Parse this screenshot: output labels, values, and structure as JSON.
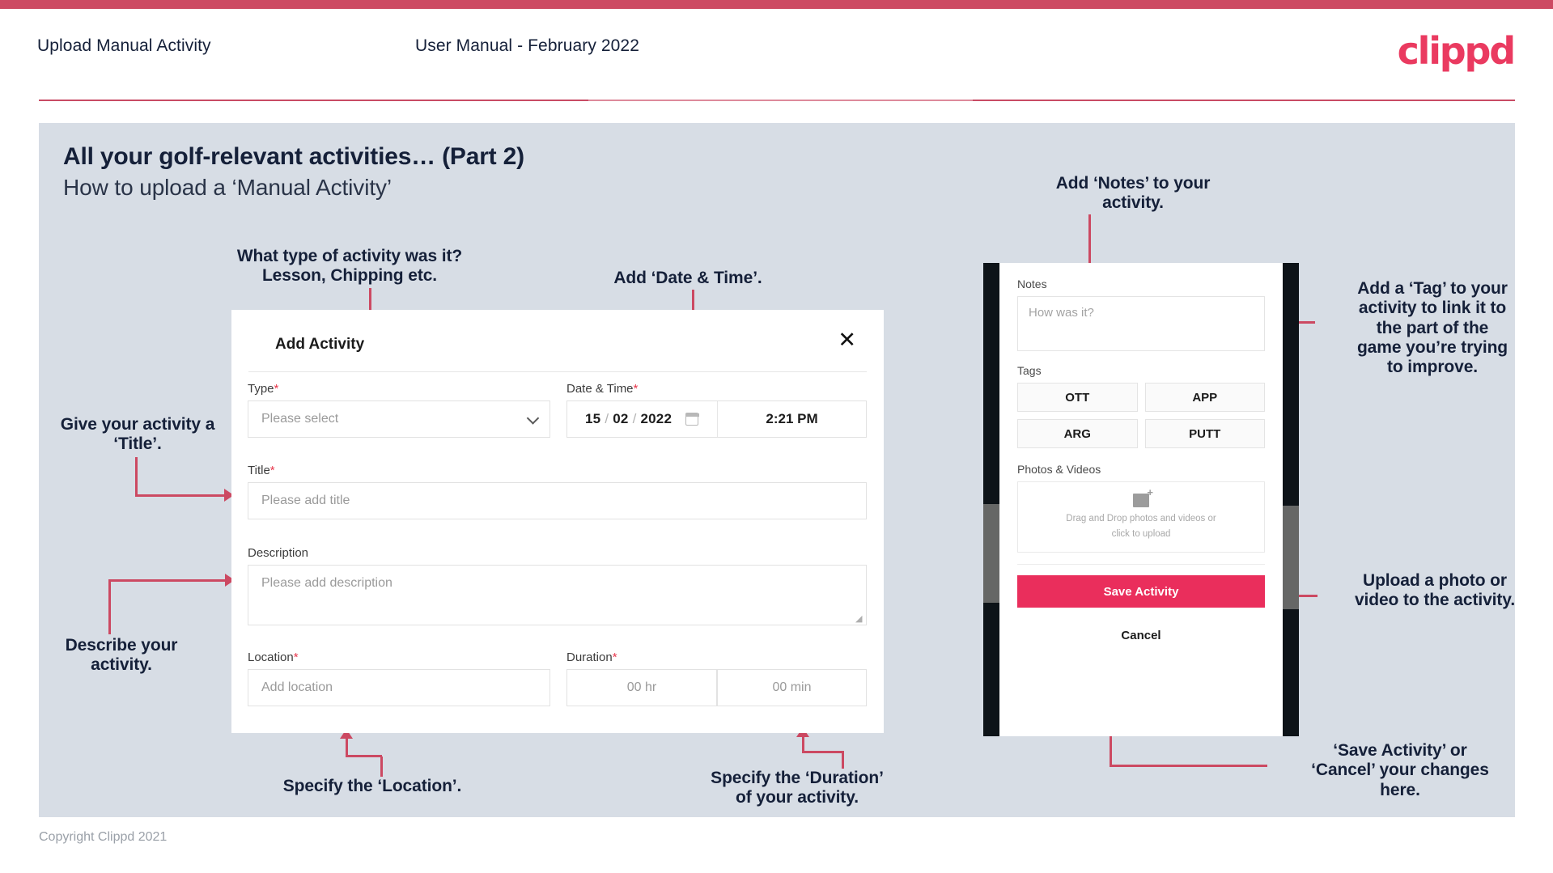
{
  "header": {
    "title": "Upload Manual Activity",
    "subtitle": "User Manual - February 2022",
    "logo": "clippd"
  },
  "slide": {
    "heading": "All your golf-relevant activities… (Part 2)",
    "subheading": "How to upload a ‘Manual Activity’"
  },
  "annotations": {
    "type": "What type of activity was it?\nLesson, Chipping etc.",
    "datetime": "Add ‘Date & Time’.",
    "title": "Give your activity a\n‘Title’.",
    "description": "Describe your\nactivity.",
    "location": "Specify the ‘Location’.",
    "duration": "Specify the ‘Duration’\nof your activity.",
    "notes": "Add ‘Notes’ to your\nactivity.",
    "tags": "Add a ‘Tag’ to your\nactivity to link it to\nthe part of the\ngame you’re trying\nto improve.",
    "upload": "Upload a photo or\nvideo to the activity.",
    "save": "‘Save Activity’ or\n‘Cancel’ your changes\nhere."
  },
  "modal": {
    "title": "Add Activity",
    "close_icon": "✕",
    "fields": {
      "type": {
        "label": "Type",
        "required": "*",
        "placeholder": "Please select"
      },
      "datetime": {
        "label": "Date & Time",
        "required": "*",
        "day": "15",
        "month": "02",
        "year": "2022",
        "sep": "/",
        "time": "2:21 PM"
      },
      "title": {
        "label": "Title",
        "required": "*",
        "placeholder": "Please add title"
      },
      "description": {
        "label": "Description",
        "required": "",
        "placeholder": "Please add description"
      },
      "location": {
        "label": "Location",
        "required": "*",
        "placeholder": "Add location"
      },
      "duration": {
        "label": "Duration",
        "required": "*",
        "hours": "00 hr",
        "minutes": "00 min"
      }
    }
  },
  "phone": {
    "notes_label": "Notes",
    "notes_placeholder": "How was it?",
    "tags_label": "Tags",
    "tags": [
      "OTT",
      "APP",
      "ARG",
      "PUTT"
    ],
    "photos_label": "Photos & Videos",
    "dropzone_line1": "Drag and Drop photos and videos or",
    "dropzone_line2": "click to upload",
    "save_label": "Save Activity",
    "cancel_label": "Cancel"
  },
  "footer": {
    "copyright": "Copyright Clippd 2021"
  },
  "colors": {
    "accent": "#cd4a63",
    "brand_pink": "#ea3a60",
    "save_button": "#ea2e5c",
    "slide_bg": "#d7dde5",
    "text_dark": "#152039",
    "required_red": "#e8374c"
  }
}
